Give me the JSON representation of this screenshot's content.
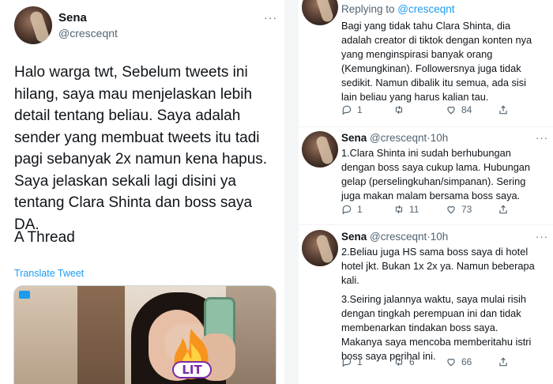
{
  "left_tweet": {
    "name": "Sena",
    "handle": "@cresceqnt",
    "more": "···",
    "text_lines": [
      "Halo warga twt, Sebelum tweets ini",
      "hilang, saya mau menjelaskan lebih",
      "detail tentang beliau. Saya adalah",
      "sender yang membuat tweets itu tadi",
      "pagi sebanyak 2x namun kena hapus.",
      "Saya jelaskan sekali lagi disini ya",
      "tentang Clara Shinta dan boss saya",
      "DA."
    ],
    "thread_label": "A Thread",
    "translate_label": "Translate Tweet",
    "media_sticker_label": "LIT"
  },
  "right_thread": {
    "replying_prefix": "Replying to ",
    "replying_mention": "@cresceqnt",
    "tweets": [
      {
        "lines": [
          "Bagi yang tidak tahu Clara Shinta, dia",
          "adalah creator di tiktok dengan konten nya",
          "yang menginspirasi banyak orang",
          "(Kemungkinan). Followersnya juga tidak",
          "sedikit. Namun dibalik itu semua, ada sisi",
          "lain beliau yang harus kalian tau."
        ],
        "replies": "1",
        "retweets": "",
        "likes": "84"
      },
      {
        "name": "Sena",
        "handle": "@cresceqnt",
        "time": "·10h",
        "lines": [
          "1.Clara Shinta ini sudah berhubungan",
          "dengan boss saya cukup lama. Hubungan",
          "gelap (perselingkuhan/simpanan). Sering",
          "juga makan malam bersama boss saya."
        ],
        "replies": "1",
        "retweets": "11",
        "likes": "73"
      },
      {
        "name": "Sena",
        "handle": "@cresceqnt",
        "time": "·10h",
        "lines": [
          "2.Beliau juga HS sama boss saya di hotel",
          "hotel jkt. Bukan 1x 2x ya. Namun beberapa",
          "kali.",
          "",
          "3.Seiring jalannya waktu, saya mulai risih",
          "dengan tingkah perempuan ini dan tidak",
          "membenarkan tindakan boss saya.",
          "Makanya saya mencoba memberitahu istri",
          "boss saya perihal ini."
        ],
        "replies": "1",
        "retweets": "6",
        "likes": "66"
      }
    ],
    "more": "···"
  },
  "colors": {
    "accent": "#1d9bf0",
    "text": "#0f1419",
    "muted": "#536471"
  },
  "icons": [
    "reply-icon",
    "retweet-icon",
    "like-icon",
    "share-icon",
    "more-icon",
    "fire-icon"
  ]
}
